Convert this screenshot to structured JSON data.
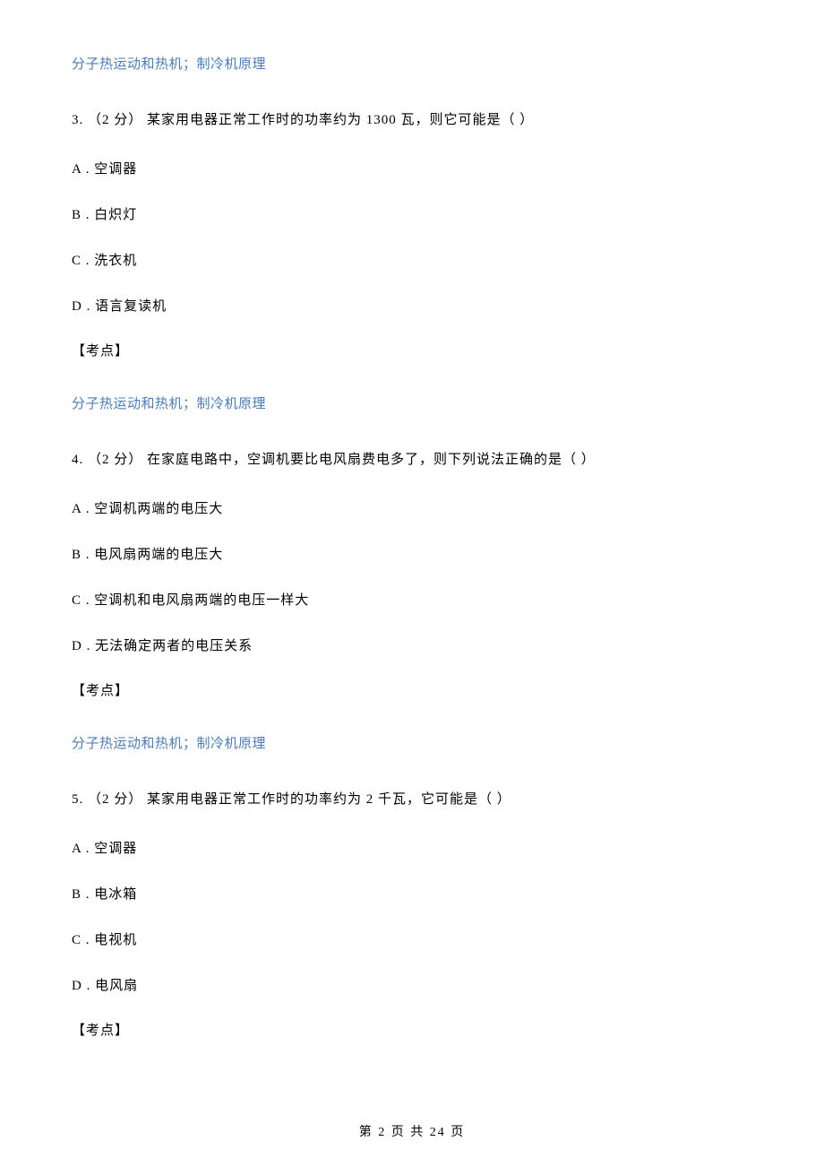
{
  "topic_link_1": "分子热运动和热机；制冷机原理",
  "question_3": {
    "text": "3. （2 分） 某家用电器正常工作时的功率约为 1300 瓦，则它可能是（    ）",
    "option_a": "A . 空调器",
    "option_b": "B . 白炽灯",
    "option_c": "C . 洗衣机",
    "option_d": "D . 语言复读机",
    "kaodian": "【考点】"
  },
  "topic_link_2": "分子热运动和热机；制冷机原理",
  "question_4": {
    "text": "4. （2 分） 在家庭电路中，空调机要比电风扇费电多了，则下列说法正确的是（    ）",
    "option_a": "A . 空调机两端的电压大",
    "option_b": "B . 电风扇两端的电压大",
    "option_c": "C . 空调机和电风扇两端的电压一样大",
    "option_d": "D . 无法确定两者的电压关系",
    "kaodian": "【考点】"
  },
  "topic_link_3": "分子热运动和热机；制冷机原理",
  "question_5": {
    "text": "5. （2 分） 某家用电器正常工作时的功率约为 2 千瓦，它可能是（    ）",
    "option_a": "A . 空调器",
    "option_b": "B . 电冰箱",
    "option_c": "C . 电视机",
    "option_d": "D . 电风扇",
    "kaodian": "【考点】"
  },
  "footer": "第 2 页 共 24 页"
}
